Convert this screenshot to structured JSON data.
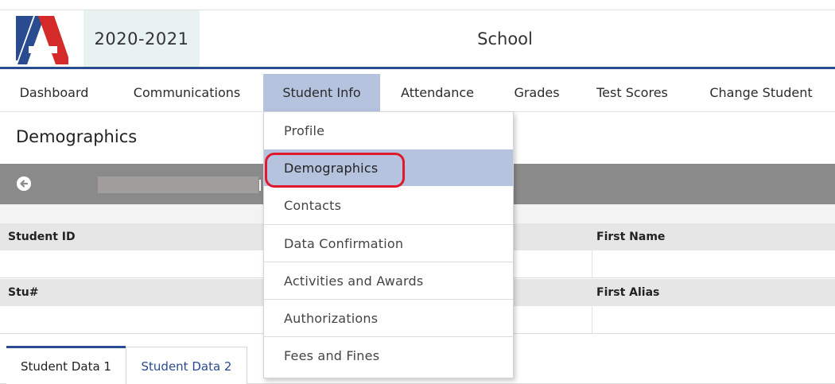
{
  "header": {
    "logo_letter": "A",
    "school_year": "2020-2021",
    "school_name": "School"
  },
  "nav": {
    "items": [
      {
        "label": "Dashboard"
      },
      {
        "label": "Communications"
      },
      {
        "label": "Student Info",
        "active": true
      },
      {
        "label": "Attendance"
      },
      {
        "label": "Grades"
      },
      {
        "label": "Test Scores"
      },
      {
        "label": "Change Student"
      }
    ]
  },
  "page": {
    "title": "Demographics"
  },
  "record_bar": {
    "back_icon": "arrow-left-circle-icon"
  },
  "grid": {
    "headers_row1": {
      "left": "Student ID",
      "right": "First Name"
    },
    "headers_row2": {
      "left": "Stu#",
      "right": "First Alias"
    }
  },
  "tabs": [
    {
      "label": "Student Data 1",
      "active": true
    },
    {
      "label": "Student Data 2",
      "active": false
    }
  ],
  "dropdown": {
    "items": [
      {
        "label": "Profile"
      },
      {
        "label": "Demographics",
        "selected": true
      },
      {
        "label": "Contacts"
      },
      {
        "label": "Data Confirmation"
      },
      {
        "label": "Activities and Awards"
      },
      {
        "label": "Authorizations"
      },
      {
        "label": "Fees and Fines"
      }
    ]
  },
  "colors": {
    "brand_blue": "#2a4b8f",
    "brand_red": "#d42a2a",
    "active_nav": "#b5c3df",
    "highlight_ring": "#e0182b"
  }
}
